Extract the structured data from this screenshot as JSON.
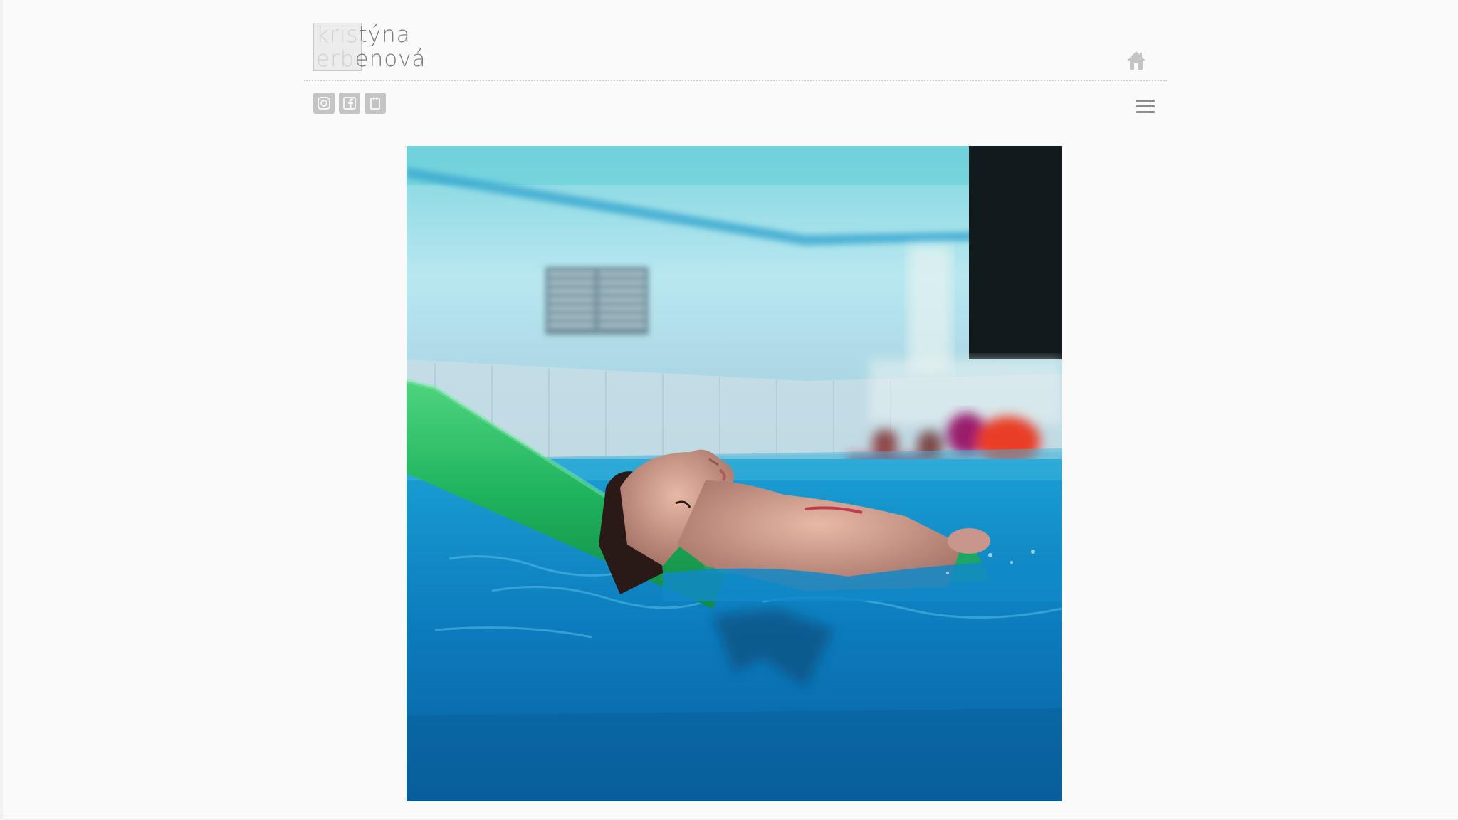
{
  "logo": {
    "line1_box": "kris",
    "line1_rest": "týna",
    "line2_box": "erb",
    "line2_rest": "enová"
  },
  "nav": {
    "home_icon": "home-icon",
    "menu_icon": "hamburger-menu-icon"
  },
  "social": [
    {
      "name": "instagram",
      "icon": "instagram-icon"
    },
    {
      "name": "facebook",
      "icon": "facebook-icon"
    },
    {
      "name": "blog",
      "icon": "notebook-icon"
    }
  ],
  "photo": {
    "subject": "girl floating on green pool noodle in swimming pool"
  },
  "colors": {
    "logo_light": "#d0d0d0",
    "logo_dark": "#7a7a7a",
    "icon_gray": "#c4c4c4",
    "water": "#0f86c4",
    "noodle": "#1fb35e"
  }
}
